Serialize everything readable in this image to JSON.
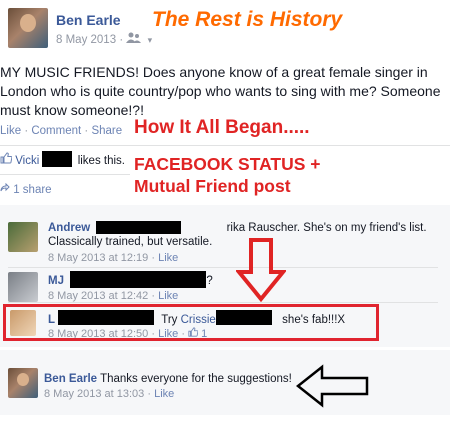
{
  "overlay": {
    "title": "The Rest is History",
    "how_began": "How It All Began.....",
    "facebook_status": "FACEBOOK STATUS +",
    "mutual_friend": "Mutual Friend post"
  },
  "post": {
    "author": "Ben Earle",
    "date": "8 May 2013",
    "audience_icon": "friends-icon",
    "text": "MY MUSIC FRIENDS! Does anyone know of a great female singer in London who is quite country/pop who wants to sing with me? Someone must know someone!?!",
    "actions": [
      "Like",
      "Comment",
      "Share"
    ],
    "separator": "·",
    "likes_name": "Vicki",
    "likes_suffix": "likes this.",
    "shares": "1 share"
  },
  "comments": [
    {
      "author": "Andrew",
      "text_visible": "rika Rauscher. She's on my friend's list. Classically trained, but versatile.",
      "date": "8 May 2013 at 12:19",
      "like": "Like"
    },
    {
      "author": "MJ",
      "text_visible": "?",
      "date": "8 May 2013 at 12:42",
      "like": "Like"
    },
    {
      "author": "L",
      "text_pre": "Try",
      "mention": "Crissie",
      "text_post": "she's fab!!!X",
      "date": "8 May 2013 at 12:50",
      "like": "Like",
      "like_count": "1"
    },
    {
      "author": "Ben Earle",
      "text_visible": "Thanks everyone for the suggestions!",
      "date": "8 May 2013 at 13:03",
      "like": "Like"
    }
  ],
  "colors": {
    "link": "#3b5998",
    "overlay_orange": "#ff6a00",
    "overlay_red": "#e02424",
    "highlight": "#e0242f"
  }
}
